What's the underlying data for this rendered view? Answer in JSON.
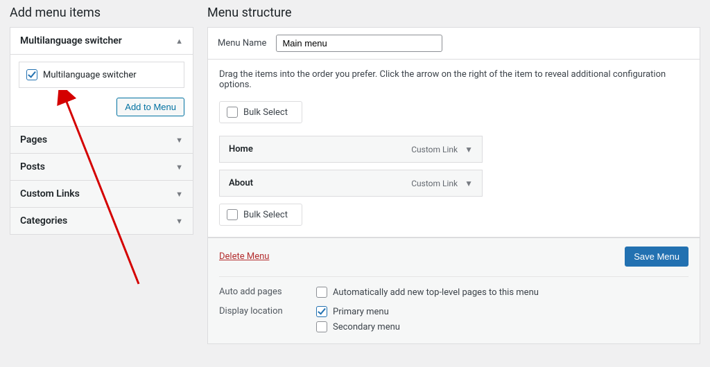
{
  "left": {
    "heading": "Add menu items",
    "accordion": {
      "expanded": {
        "title": "Multilanguage switcher",
        "checkbox_label": "Multilanguage switcher",
        "checkbox_checked": true,
        "button": "Add to Menu"
      },
      "collapsed": [
        "Pages",
        "Posts",
        "Custom Links",
        "Categories"
      ]
    }
  },
  "right": {
    "heading": "Menu structure",
    "menu_name_label": "Menu Name",
    "menu_name_value": "Main menu",
    "instructions": "Drag the items into the order you prefer. Click the arrow on the right of the item to reveal additional configuration options.",
    "bulk_select": "Bulk Select",
    "items": [
      {
        "title": "Home",
        "type": "Custom Link"
      },
      {
        "title": "About",
        "type": "Custom Link"
      }
    ],
    "delete_label": "Delete Menu",
    "save_label": "Save Menu",
    "settings": {
      "auto_add_label": "Auto add pages",
      "auto_add_option": "Automatically add new top-level pages to this menu",
      "auto_add_checked": false,
      "display_loc_label": "Display location",
      "locations": [
        {
          "label": "Primary menu",
          "checked": true
        },
        {
          "label": "Secondary menu",
          "checked": false
        }
      ]
    }
  }
}
